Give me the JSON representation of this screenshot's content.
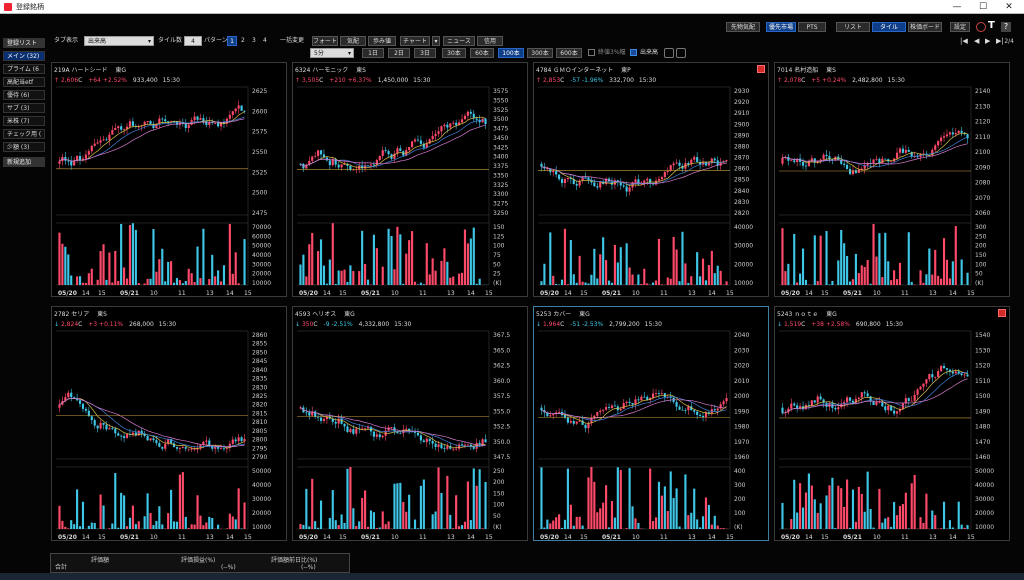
{
  "window": {
    "title": "登録銘柄",
    "min": "—",
    "max": "☐",
    "close": "✕"
  },
  "top_buttons": [
    "先物気配",
    "優先市場",
    "PTS",
    "リスト",
    "タイル",
    "株価ボード",
    "設定"
  ],
  "top_icons": [
    "clip-icon",
    "text-icon",
    "help-icon"
  ],
  "sidebar": {
    "header": "登録リスト",
    "items": [
      "メイン (32)",
      "プライム (6",
      "高配当etf",
      "優待 (6)",
      "サブ (3)",
      "米株 (7)",
      "チェック用 (",
      "少額 (3)",
      "新規追加"
    ]
  },
  "toolbar": {
    "tab_label": "タブ表示",
    "tab_value": "出来高",
    "tile_label": "タイル数",
    "tile_value": "4",
    "pattern_label": "パターン",
    "patterns": [
      "1",
      "2",
      "3",
      "4"
    ],
    "switch_label": "一括変更",
    "view_buttons": [
      "チャート",
      "ニュース",
      "信用"
    ],
    "view_buttons_top": [
      "フォート",
      "気配",
      "歩み値"
    ],
    "timeframe": "5分",
    "periods": [
      "1日",
      "2日",
      "3日",
      "30本",
      "60本",
      "100本",
      "300本",
      "600本"
    ],
    "active_period": "100本",
    "check_ma": "終値3%幅",
    "check_vol": "出来高",
    "page": "2/4",
    "nav": [
      "|◀",
      "◀",
      "▶",
      "▶|"
    ]
  },
  "panes": [
    {
      "code": "219A",
      "name": "ハートシード",
      "market": "東G",
      "dir": "up",
      "price": "2,606",
      "change": "+64",
      "pct": "+2.52%",
      "volume": "933,400",
      "time": "15:30",
      "y_ticks": [
        "2625",
        "2600",
        "2575",
        "2550",
        "2525",
        "2500",
        "2475"
      ],
      "v_ticks": [
        "70000",
        "60000",
        "50000",
        "40000",
        "30000",
        "20000",
        "10000"
      ],
      "x_ticks": [
        "05/20",
        "14",
        "15",
        "05/21",
        "10",
        "11",
        "13",
        "14",
        "15"
      ],
      "alert": false
    },
    {
      "code": "6324",
      "name": "ハーモニック",
      "market": "東S",
      "dir": "up",
      "price": "3,505",
      "change": "+210",
      "pct": "+6.37%",
      "volume": "1,450,000",
      "time": "15:30",
      "y_ticks": [
        "3575",
        "3550",
        "3525",
        "3500",
        "3475",
        "3450",
        "3425",
        "3400",
        "3375",
        "3350",
        "3325",
        "3300",
        "3275",
        "3250"
      ],
      "v_ticks": [
        "150",
        "125",
        "100",
        "75",
        "50",
        "25",
        "(K)"
      ],
      "x_ticks": [
        "05/20",
        "14",
        "15",
        "05/21",
        "10",
        "11",
        "13",
        "14",
        "15"
      ],
      "alert": false
    },
    {
      "code": "4784",
      "name": "ＧＭＯインターネット",
      "market": "東P",
      "dir": "up",
      "price": "2,853",
      "change": "-57",
      "pct": "-1.96%",
      "volume": "332,700",
      "time": "15:30",
      "y_ticks": [
        "2930",
        "2920",
        "2910",
        "2900",
        "2890",
        "2880",
        "2870",
        "2860",
        "2850",
        "2840",
        "2830",
        "2820"
      ],
      "v_ticks": [
        "40000",
        "30000",
        "20000",
        "10000"
      ],
      "x_ticks": [
        "05/20",
        "14",
        "15",
        "05/21",
        "10",
        "11",
        "13",
        "14",
        "15"
      ],
      "alert": true
    },
    {
      "code": "7014",
      "name": "名村造船",
      "market": "東S",
      "dir": "up",
      "price": "2,078",
      "change": "+5",
      "pct": "+0.24%",
      "volume": "2,482,800",
      "time": "15:30",
      "y_ticks": [
        "2140",
        "2130",
        "2120",
        "2110",
        "2100",
        "2090",
        "2080",
        "2070",
        "2060"
      ],
      "v_ticks": [
        "300",
        "250",
        "200",
        "150",
        "100",
        "50",
        "(K)"
      ],
      "x_ticks": [
        "05/20",
        "14",
        "15",
        "05/21",
        "10",
        "11",
        "13",
        "14",
        "15"
      ],
      "alert": false
    },
    {
      "code": "2782",
      "name": "セリア",
      "market": "東S",
      "dir": "down",
      "price": "2,824",
      "change": "+3",
      "pct": "+0.11%",
      "volume": "268,000",
      "time": "15:30",
      "y_ticks": [
        "2860",
        "2855",
        "2850",
        "2845",
        "2840",
        "2835",
        "2830",
        "2825",
        "2820",
        "2815",
        "2810",
        "2805",
        "2800",
        "2795",
        "2790"
      ],
      "v_ticks": [
        "50000",
        "40000",
        "30000",
        "20000",
        "10000"
      ],
      "x_ticks": [
        "05/20",
        "14",
        "15",
        "05/21",
        "10",
        "11",
        "13",
        "14",
        "15"
      ],
      "alert": false
    },
    {
      "code": "4593",
      "name": "ヘリオス",
      "market": "東G",
      "dir": "down",
      "price": "350",
      "change": "-9",
      "pct": "-2.51%",
      "volume": "4,332,800",
      "time": "15:30",
      "y_ticks": [
        "367.5",
        "365.0",
        "362.5",
        "360.0",
        "357.5",
        "355.0",
        "352.5",
        "350.0",
        "347.5"
      ],
      "v_ticks": [
        "250",
        "200",
        "150",
        "100",
        "50",
        "(K)"
      ],
      "x_ticks": [
        "05/20",
        "14",
        "15",
        "05/21",
        "10",
        "11",
        "13",
        "14",
        "15"
      ],
      "alert": false
    },
    {
      "code": "5253",
      "name": "カバー",
      "market": "東G",
      "dir": "down",
      "price": "1,964",
      "change": "-51",
      "pct": "-2.53%",
      "volume": "2,799,200",
      "time": "15:30",
      "y_ticks": [
        "2040",
        "2030",
        "2020",
        "2010",
        "2000",
        "1990",
        "1980",
        "1970",
        "1960"
      ],
      "v_ticks": [
        "400",
        "300",
        "200",
        "100",
        "(K)"
      ],
      "x_ticks": [
        "05/20",
        "14",
        "15",
        "05/21",
        "10",
        "11",
        "13",
        "14",
        "15"
      ],
      "alert": false
    },
    {
      "code": "5243",
      "name": "ｎｏｔｅ",
      "market": "東G",
      "dir": "down",
      "price": "1,519",
      "change": "+38",
      "pct": "+2.58%",
      "volume": "690,800",
      "time": "15:30",
      "y_ticks": [
        "1540",
        "1530",
        "1520",
        "1510",
        "1500",
        "1490",
        "1480",
        "1470",
        "1460"
      ],
      "v_ticks": [
        "50000",
        "40000",
        "30000",
        "20000",
        "10000"
      ],
      "x_ticks": [
        "05/20",
        "14",
        "15",
        "05/21",
        "10",
        "11",
        "13",
        "14",
        "15"
      ],
      "alert": true
    }
  ],
  "price_suffix": "C",
  "bottom": {
    "total_label": "合計",
    "col1": "評価額",
    "col2": "評価損益(%)",
    "col3": "評価額前日比(%)",
    "v1": "",
    "v2": "(--%)",
    "v3": "(--%)"
  },
  "colors": {
    "up": "#ff4a6a",
    "down": "#3fc7e8",
    "ma1": "#d6c24a",
    "ma2": "#d77bd0",
    "ma3": "#3f7fd6",
    "ma4": "#e8a23a",
    "hline": "#c8a040"
  }
}
